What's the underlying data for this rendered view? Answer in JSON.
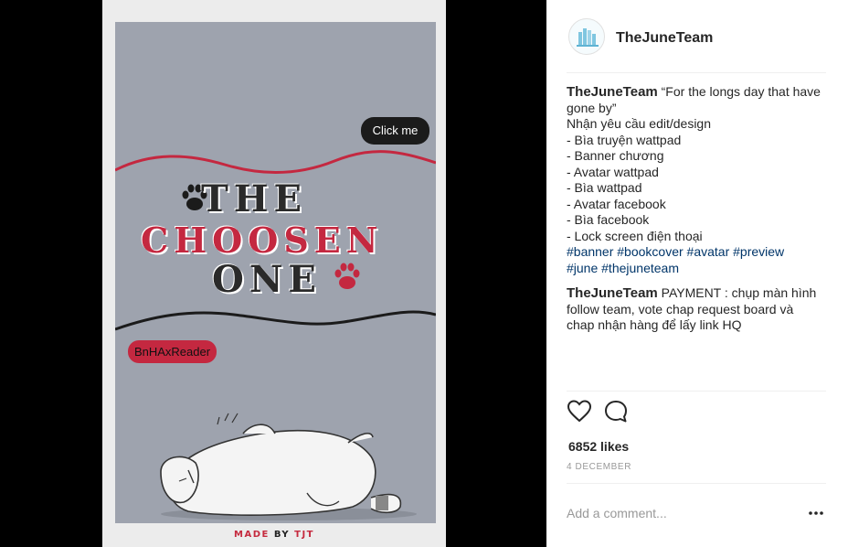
{
  "post": {
    "image": {
      "bubble_top": "Click me",
      "title_line1": "THE",
      "title_line2": "CHOOSEN",
      "title_line3": "ONE",
      "bubble_bottom": "BnHAxReader",
      "footer_made": "MADE",
      "footer_by": "BY",
      "footer_team": "TJT"
    },
    "header": {
      "username": "TheJuneTeam"
    },
    "comments": [
      {
        "author": "TheJuneTeam",
        "lines": [
          "“For the longs day that have gone by”",
          "Nhận yêu cầu edit/design",
          "- Bìa truyện wattpad",
          "- Banner chương",
          "- Avatar wattpad",
          "- Bìa wattpad",
          "- Avatar facebook",
          "- Bìa facebook",
          "- Lock screen điện thoại"
        ],
        "hashtags_line1": "#banner #bookcover #avatar #preview",
        "hashtags_line2": "#june #thejuneteam"
      },
      {
        "author": "TheJuneTeam",
        "text": "PAYMENT : chụp màn hình follow team, vote chap request board và chap nhận hàng để lấy link HQ"
      }
    ],
    "likes": "6852 likes",
    "date": "4 DECEMBER",
    "comment_placeholder": "Add a comment...",
    "icons": {
      "like": "heart-icon",
      "comment": "speech-bubble-icon",
      "more": "more-options-icon"
    },
    "colors": {
      "accent_red": "#c42840",
      "hashtag": "#003569",
      "poster_bg": "#9ea3ae"
    }
  }
}
